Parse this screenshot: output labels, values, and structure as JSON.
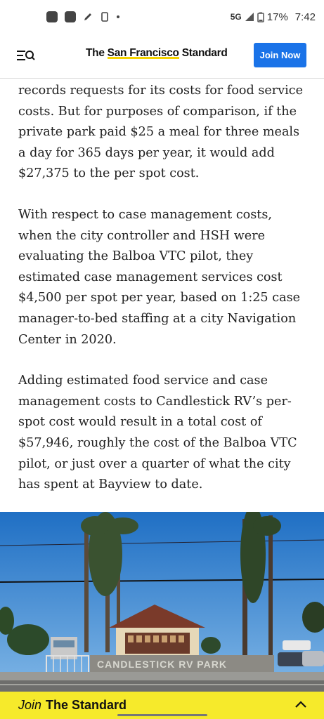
{
  "status_bar": {
    "network": "5G",
    "battery": "17%",
    "time": "7:42"
  },
  "header": {
    "brand_prefix": "The ",
    "brand_highlight": "San Francisco",
    "brand_suffix": " Standard",
    "join_label": "Join Now"
  },
  "article": {
    "paragraphs": [
      "records requests for its costs for food service costs. But for purposes of comparison, if the private park paid $25 a meal for three meals a day for 365 days per year, it would add $27,375 to the per spot cost.",
      "With respect to case management costs, when the city controller and HSH were evaluating the Balboa VTC pilot, they estimated case management services cost $4,500 per spot per year, based on 1:25 case manager-to-bed staffing at a city Navigation Center in 2020.",
      "Adding estimated food service and case management costs to Candlestick RV’s per-spot cost would result in a total cost of $57,946, roughly the cost of the Balboa VTC pilot, or just over a quarter of what the city has spent at Bayview to date."
    ]
  },
  "photo": {
    "sign_text": "CANDLESTICK RV PARK"
  },
  "join_bar": {
    "prefix": "Join",
    "label": "The Standard"
  },
  "icons": {
    "menu": "menu-search-icon",
    "chevron": "chevron-up-icon"
  },
  "colors": {
    "accent": "#1a73e8",
    "highlight": "#f6d400",
    "join_bar": "#f6ea2b",
    "sky": "#2f86d6"
  }
}
